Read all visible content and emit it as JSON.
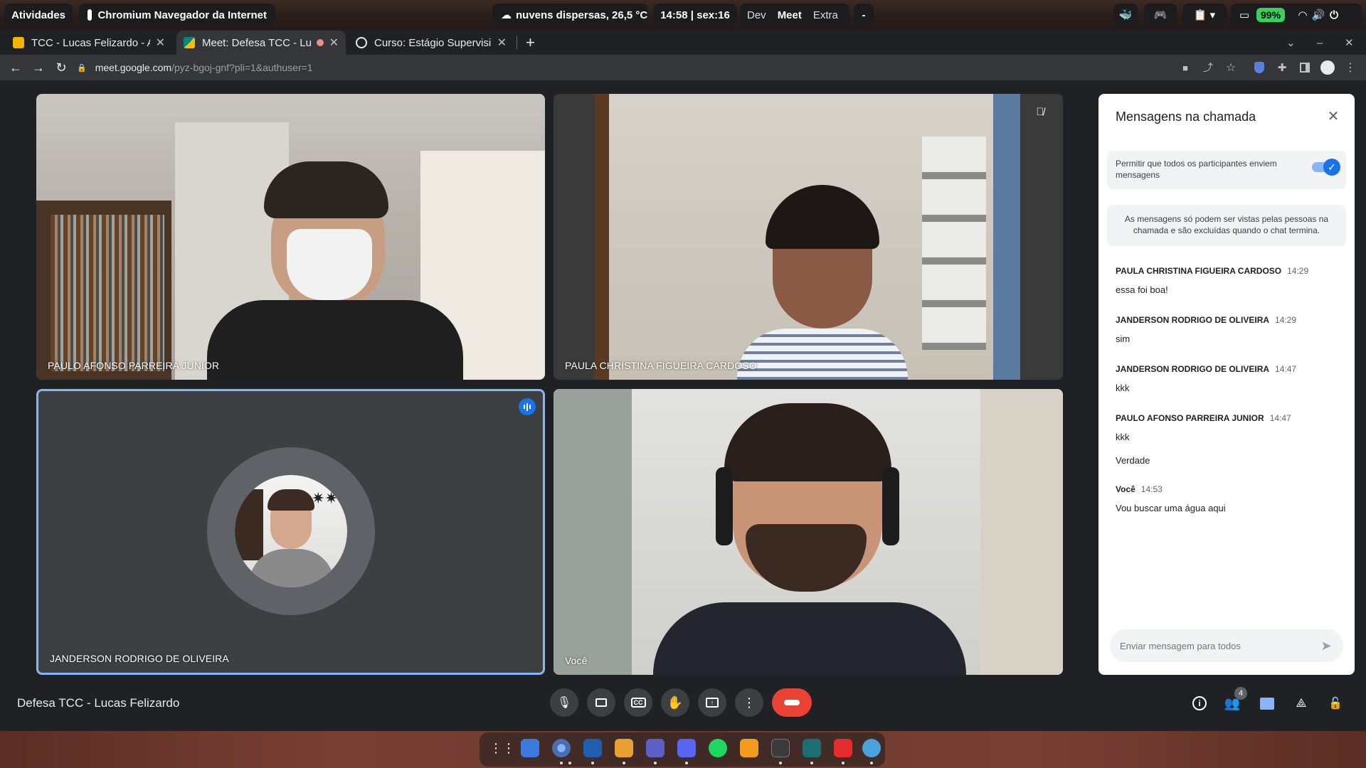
{
  "topbar": {
    "activities": "Atividades",
    "app_name": "Chromium Navegador da Internet",
    "weather": "nuvens dispersas, 26,5 °C",
    "clock": "14:58 | sex:16",
    "workspaces": [
      "Dev",
      "Meet",
      "Extra"
    ],
    "workspace_extra": "-",
    "battery": "99%"
  },
  "tabs": [
    {
      "title": "TCC - Lucas Felizardo - Ap",
      "favicon_color": "#f4b400"
    },
    {
      "title": "Meet: Defesa TCC - Lu",
      "favicon_color": "#00897b",
      "recording": true
    },
    {
      "title": "Curso: Estágio Supervisio",
      "favicon_color": "#e8eaed"
    }
  ],
  "toolbar": {
    "url_host": "meet.google.com",
    "url_path": "/pyz-bgoj-gnf?pli=1&authuser=1"
  },
  "participants": [
    {
      "name": "PAULO AFONSO PARREIRA JUNIOR"
    },
    {
      "name": "PAULA CHRISTINA FIGUEIRA CARDOSO",
      "muted": true
    },
    {
      "name": "JANDERSON RODRIGO DE OLIVEIRA",
      "speaking": true
    },
    {
      "name": "Você"
    }
  ],
  "chat": {
    "title": "Mensagens na chamada",
    "toggle_label": "Permitir que todos os participantes enviem mensagens",
    "toggle_on": true,
    "info": "As mensagens só podem ser vistas pelas pessoas na chamada e são excluídas quando o chat termina.",
    "messages": [
      {
        "sender": "PAULA CHRISTINA FIGUEIRA CARDOSO",
        "time": "14:29",
        "lines": [
          "essa foi boa!"
        ]
      },
      {
        "sender": "JANDERSON RODRIGO DE OLIVEIRA",
        "time": "14:29",
        "lines": [
          "sim"
        ]
      },
      {
        "sender": "JANDERSON RODRIGO DE OLIVEIRA",
        "time": "14:47",
        "lines": [
          "kkk"
        ]
      },
      {
        "sender": "PAULO AFONSO PARREIRA JUNIOR",
        "time": "14:47",
        "lines": [
          "kkk",
          "Verdade"
        ]
      },
      {
        "sender": "Você",
        "time": "14:53",
        "lines": [
          "Vou buscar uma água aqui"
        ]
      }
    ],
    "input_placeholder": "Enviar mensagem para todos"
  },
  "meeting_title": "Defesa TCC - Lucas Felizardo",
  "people_count": "4",
  "colors": {
    "accent": "#1a73e8",
    "end_call": "#ea4335",
    "chat_icon": "#8ab4f8",
    "battery": "#3ad05a"
  },
  "dock_apps": [
    {
      "name": "app-grid"
    },
    {
      "name": "files"
    },
    {
      "name": "chromium"
    },
    {
      "name": "vscode"
    },
    {
      "name": "sublime"
    },
    {
      "name": "teams"
    },
    {
      "name": "discord"
    },
    {
      "name": "spotify"
    },
    {
      "name": "notes"
    },
    {
      "name": "terminal"
    },
    {
      "name": "android"
    },
    {
      "name": "pdf"
    },
    {
      "name": "mysql"
    }
  ]
}
